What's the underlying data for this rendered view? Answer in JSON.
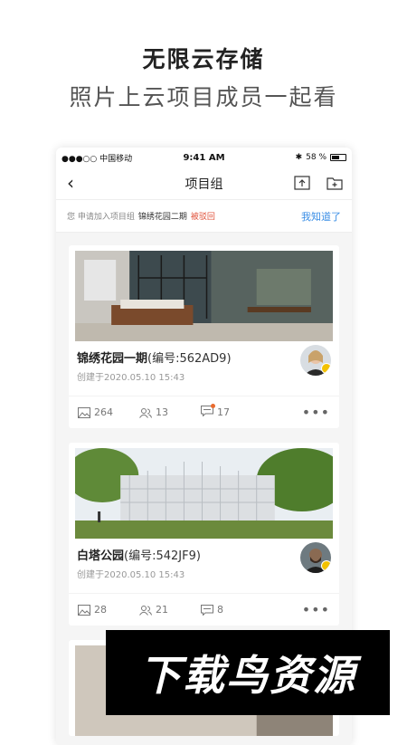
{
  "promo": {
    "title": "无限云存储",
    "subtitle": "照片上云项目成员一起看"
  },
  "status_bar": {
    "carrier": "●●●○○ 中国移动",
    "time": "9:41 AM",
    "battery": "58 %"
  },
  "nav": {
    "title": "项目组",
    "back_icon": "chevron-left-icon",
    "upload_icon": "upload-icon",
    "new_folder_icon": "folder-add-icon"
  },
  "notice": {
    "prefix": "您 申请加入项目组",
    "project": "锦绣花园二期",
    "status": "被驳回",
    "action": "我知道了"
  },
  "projects": [
    {
      "name": "锦绣花园一期",
      "code": "(编号:562AD9)",
      "created": "创建于2020.05.10   15:43",
      "photos": "264",
      "members": "13",
      "comments": "17",
      "has_unread": true
    },
    {
      "name": "白塔公园",
      "code": "(编号:542JF9)",
      "created": "创建于2020.05.10   15:43",
      "photos": "28",
      "members": "21",
      "comments": "8",
      "has_unread": false
    }
  ],
  "watermark": "下载鸟资源",
  "colors": {
    "accent": "#3a8ee6",
    "rejected": "#e0523b",
    "badge": "#f3c200"
  }
}
